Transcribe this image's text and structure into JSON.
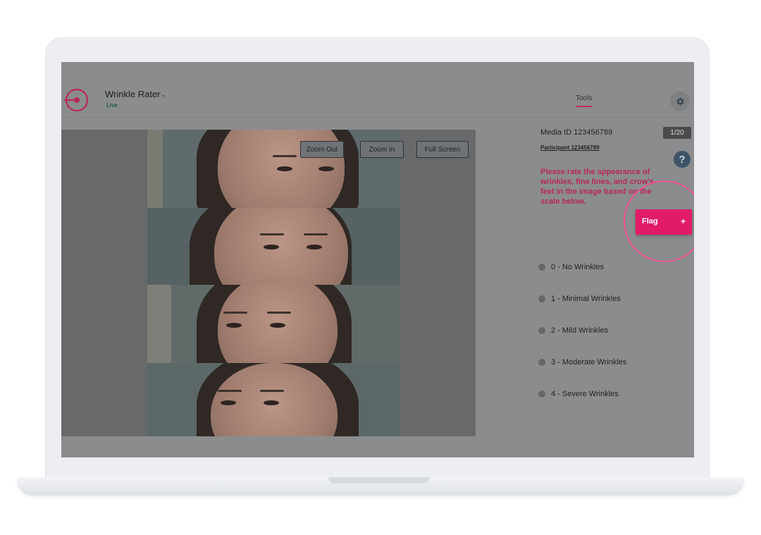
{
  "app": {
    "title": "Wrinkle Rater",
    "status": "Live"
  },
  "nav": {
    "tools_tab": "Tools"
  },
  "viewer": {
    "zoom_out": "Zoom Out",
    "zoom_in": "Zoom In",
    "full_screen": "Full Screen"
  },
  "media": {
    "id_text": "Media ID 123456789",
    "participant_text": "Participant 123456789",
    "counter": "1/20"
  },
  "instruction": "Please rate the appearance of wrinkles, fine lines, and crow's feet in the image based on the scale below.",
  "flag": {
    "label": "Flag",
    "plus": "+"
  },
  "help_glyph": "?",
  "rating_options": [
    {
      "label": "0 - No Wrinkles"
    },
    {
      "label": "1 - Minimal Wrinkles"
    },
    {
      "label": "2 - Mild Wrinkles"
    },
    {
      "label": "3 - Moderate Wrinkles"
    },
    {
      "label": "4 - Severe Wrinkles"
    }
  ],
  "colors": {
    "accent": "#e21b69",
    "instruction": "#b8285a",
    "overlay_bg": "#8b8c8e",
    "live": "#215c3c"
  },
  "icons": [
    "target-logo-icon",
    "chevron-down-icon",
    "gear-icon",
    "help-icon",
    "plus-icon"
  ]
}
